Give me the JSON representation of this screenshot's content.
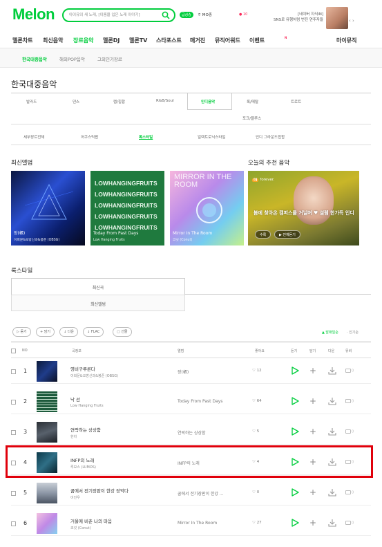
{
  "header": {
    "logo": "Melon",
    "search_placeholder": "아이유의 새 노래, [이름을 입은 노래 이야기]",
    "live_badge": "급상승",
    "mo_tag": "ㅎ MO중",
    "pink_tag": "● 10",
    "ad_line1": "[네이버 지식iN]",
    "ad_line2": "SNS로 유행처럼 번진 연주자들",
    "ad_arrows": "‹ ›"
  },
  "gnb": {
    "items": [
      "멜론차트",
      "최신음악",
      "장르음악",
      "멜론DJ",
      "멜론TV",
      "스타포스트",
      "매거진",
      "뮤직어워드",
      "이벤트"
    ],
    "badge": "N",
    "right": "마이뮤직"
  },
  "subnav": {
    "items": [
      "한국대중음악",
      "해외POP음악",
      "그외인기장르"
    ]
  },
  "page_title": "한국대중음악",
  "genres": {
    "row1": [
      "발라드",
      "댄스",
      "랩/힙합",
      "R&B/Soul",
      "인디음악",
      "록/메탈",
      "트로트"
    ],
    "row2": "포크/블루스"
  },
  "styles": [
    "세부장르전체",
    "어쿠스틱팝",
    "록스타일",
    "일렉트로닉스타일",
    "인디 그라운드힙합"
  ],
  "latest": {
    "title": "최신앨범",
    "albums": [
      {
        "title": "장(帳)",
        "artist": "이희문&오방신과&봉준 (OBSG)"
      },
      {
        "title": "Today From Past Days",
        "artist": "Low Hanging Fruits"
      },
      {
        "title": "Mirror In The Room",
        "artist": "코넛 (Conut)"
      }
    ],
    "banner2_text": "LOWHANGINGFRUITS",
    "banner3_text": "MIRROR IN THE ROOM"
  },
  "reco": {
    "title": "오늘의 추천 음악",
    "tag": "DJ",
    "label": "forever.",
    "message": "봄에 찾아온 캠퍼스를 거닐며 ♥ 설렘 한가득 인디",
    "btn1": "수록",
    "btn2": "▶ 전체듣기"
  },
  "tabs": {
    "title": "록스타일",
    "tab1": "최신곡",
    "tab2": "최신앨범"
  },
  "toolbar": {
    "buttons": [
      "듣기",
      "담기",
      "다운",
      "FLAC",
      "선물"
    ],
    "right1": "▲ 발매일순",
    "right2": "· 인기순"
  },
  "table": {
    "headers": [
      "NO",
      "곡정보",
      "앨범",
      "좋아요",
      "듣기",
      "담기",
      "다운",
      "뮤비"
    ],
    "rows": [
      {
        "no": "1",
        "title": "영비구루론다",
        "artist": "이희문&오방신과&봉준 (OBSG)",
        "album": "장(帳)",
        "likes": "12",
        "mv": "0",
        "thumb": "linear-gradient(135deg,#0c1b3a,#1f3c8a 50%,#0a0f24)"
      },
      {
        "no": "2",
        "title": "낙 선",
        "artist": "Low Hanging Fruits",
        "album": "Today From Past Days",
        "likes": "64",
        "mv": "0",
        "thumb": "repeating-linear-gradient(180deg,#1d5a3c 0,#1d5a3c 3px,#c9e3d2 3px,#c9e3d2 4px)"
      },
      {
        "no": "3",
        "title": "연락하는 상상함",
        "artist": "한차",
        "album": "연락하는 상상함",
        "likes": "5",
        "mv": "0",
        "thumb": "linear-gradient(160deg,#2a2f35,#58616c 50%,#1b1f25)"
      },
      {
        "no": "4",
        "title": "INFP의 노래",
        "artist": "루모스 (LUMOS)",
        "album": "INFP의 노래",
        "likes": "4",
        "mv": "0",
        "thumb": "linear-gradient(135deg,#0d3a4a,#2f6f86 50%,#08222c)"
      },
      {
        "no": "5",
        "title": "꿈에서 전기장판이 한강 장악다",
        "artist": "이진우",
        "album": "꿈에서 전기장판이 한강 ...",
        "likes": "0",
        "mv": "0",
        "thumb": "linear-gradient(180deg,#c8ced6,#8d97a6 50%,#4c5563)"
      },
      {
        "no": "6",
        "title": "거울에 비춘 나의 마음",
        "artist": "코넛 (Conut)",
        "album": "Mirror In The Room",
        "likes": "27",
        "mv": "0",
        "thumb": "linear-gradient(135deg,#f3c1e1,#c089e6 50%,#86d0ef)"
      }
    ]
  }
}
